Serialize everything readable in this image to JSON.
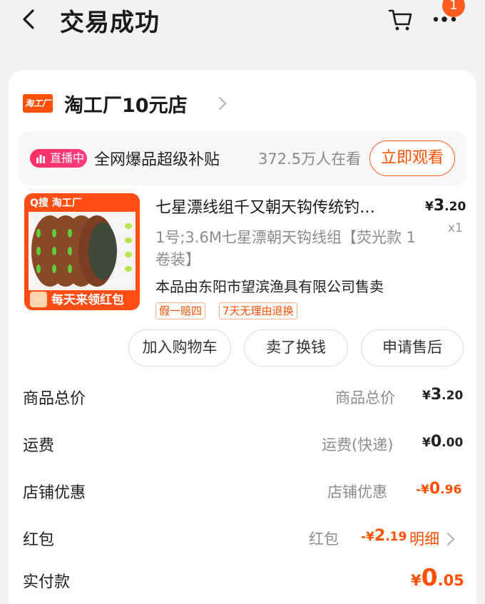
{
  "header": {
    "title": "交易成功",
    "more_badge": "1"
  },
  "shop": {
    "logo_text": "淘工厂",
    "name": "淘工厂10元店"
  },
  "live": {
    "badge": "直播中",
    "title": "全网爆品超级补贴",
    "viewers": "372.5万人在看",
    "watch_label": "立即观看"
  },
  "product": {
    "image_brand": "Q搜 淘工厂",
    "image_banner": "每天来领红包",
    "title": "七星漂线组千又朝天钩传统钓…",
    "price_symbol": "¥",
    "price_int": "3",
    "price_dec": ".20",
    "quantity": "x1",
    "spec": "1号;3.6M七星漂朝天钩线组【荧光款 1卷装】",
    "seller": "本品由东阳市望滨渔具有限公司售卖",
    "tags": [
      "假一赔四",
      "7天无理由退换"
    ]
  },
  "actions": {
    "add_cart": "加入购物车",
    "sell": "卖了换钱",
    "after_sale": "申请售后"
  },
  "summary": {
    "total": {
      "label": "商品总价",
      "sub": "商品总价",
      "symbol": "¥",
      "int": "3",
      "dec": ".20"
    },
    "shipping": {
      "label": "运费",
      "sub": "运费(快递)",
      "symbol": "¥",
      "int": "0",
      "dec": ".00"
    },
    "shop_discount": {
      "label": "店铺优惠",
      "sub": "店铺优惠",
      "symbol": "-¥",
      "int": "0",
      "dec": ".96"
    },
    "red_packet": {
      "label": "红包",
      "sub": "红包",
      "symbol": "-¥",
      "int": "2",
      "dec": ".19",
      "link": "明细"
    },
    "paid": {
      "label": "实付款",
      "symbol": "¥",
      "int": "0",
      "dec": ".05"
    }
  },
  "colors": {
    "accent": "#ff5000",
    "live": "#ff2e63"
  }
}
